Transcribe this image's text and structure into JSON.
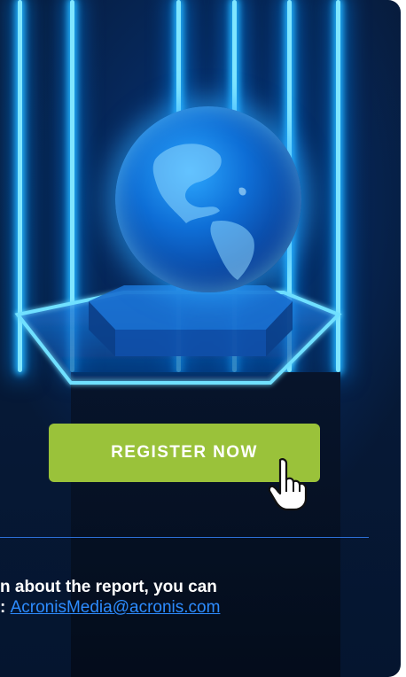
{
  "cta": {
    "register_label": "REGISTER NOW"
  },
  "footer": {
    "line1": "n about the report, you can",
    "line2_prefix": ":",
    "email": "AcronisMedia@acronis.com"
  },
  "icons": {
    "cursor": "hand-pointer-icon",
    "hero": "globe-hologram-image"
  },
  "colors": {
    "button": "#9ac23a",
    "link": "#2d8cff",
    "background": "#061a38",
    "glow": "#23b4ff"
  }
}
